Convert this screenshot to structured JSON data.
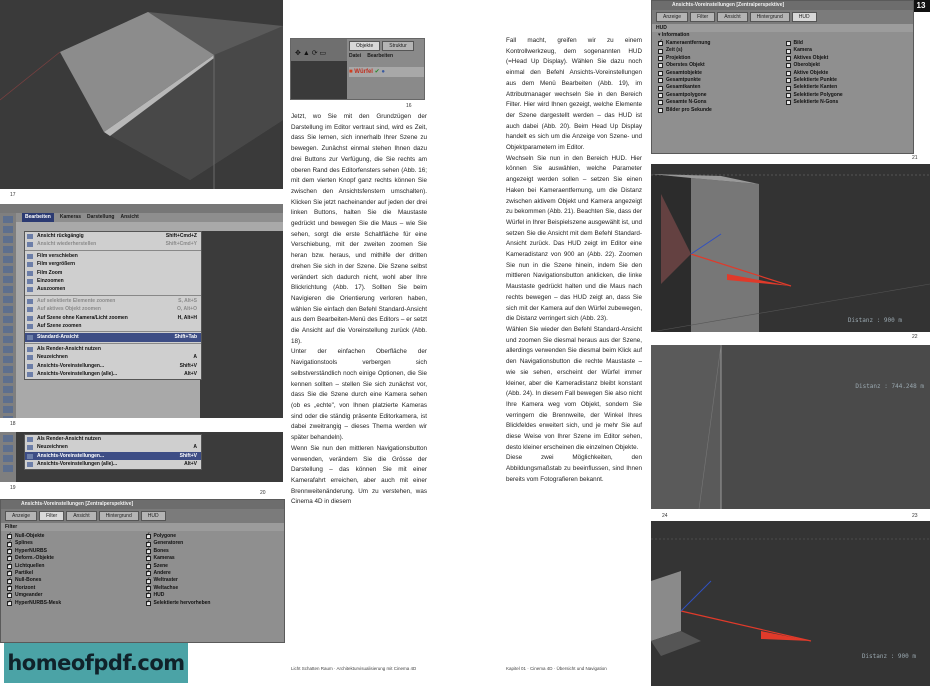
{
  "page_numbers": {
    "left": "12",
    "right": "13"
  },
  "figure_numbers": {
    "f16": "16",
    "f17": "17",
    "f18": "18",
    "f19": "19",
    "f20": "20",
    "f21": "21",
    "f22": "22",
    "f23": "23",
    "f24": "24"
  },
  "fig16": {
    "tabs": [
      "Objekte",
      "Struktur"
    ],
    "menu": [
      "Datei",
      "Bearbeiten"
    ],
    "object_label": "Würfel"
  },
  "fig18": {
    "menubar": [
      "Bearbeiten",
      "Kameras",
      "Darstellung",
      "Ansicht"
    ],
    "items": [
      {
        "label": "Ansicht rückgängig",
        "shortcut": "Shift+Cmd+Z",
        "state": ""
      },
      {
        "label": "Ansicht wiederherstellen",
        "shortcut": "Shift+Cmd+Y",
        "state": "dim"
      },
      {
        "label": "Film verschieben",
        "shortcut": "",
        "state": ""
      },
      {
        "label": "Film vergrößern",
        "shortcut": "",
        "state": ""
      },
      {
        "label": "Film Zoom",
        "shortcut": "",
        "state": ""
      },
      {
        "label": "Einzoomen",
        "shortcut": "",
        "state": ""
      },
      {
        "label": "Auszoomen",
        "shortcut": "",
        "state": ""
      },
      {
        "label": "Auf selektierte Elemente zoomen",
        "shortcut": "S, Alt+S",
        "state": "dim"
      },
      {
        "label": "Auf aktives Objekt zoomen",
        "shortcut": "O, Alt+O",
        "state": "dim"
      },
      {
        "label": "Auf Szene ohne Kamera/Licht zoomen",
        "shortcut": "H, Alt+H",
        "state": ""
      },
      {
        "label": "Auf Szene zoomen",
        "shortcut": "",
        "state": ""
      },
      {
        "label": "Standard-Ansicht",
        "shortcut": "Shift+Tab",
        "state": "hl"
      },
      {
        "label": "Als Render-Ansicht nutzen",
        "shortcut": "",
        "state": ""
      },
      {
        "label": "Neuzeichnen",
        "shortcut": "A",
        "state": ""
      },
      {
        "label": "Ansichts-Voreinstellungen...",
        "shortcut": "Shift+V",
        "state": ""
      },
      {
        "label": "Ansichts-Voreinstellungen (alle)...",
        "shortcut": "Alt+V",
        "state": ""
      }
    ]
  },
  "fig19": {
    "items": [
      {
        "label": "Als Render-Ansicht nutzen",
        "shortcut": "",
        "state": ""
      },
      {
        "label": "Neuzeichnen",
        "shortcut": "A",
        "state": ""
      },
      {
        "label": "Ansichts-Voreinstellungen...",
        "shortcut": "Shift+V",
        "state": "hl"
      },
      {
        "label": "Ansichts-Voreinstellungen (alle)...",
        "shortcut": "Alt+V",
        "state": ""
      }
    ]
  },
  "fig20": {
    "title": "Ansichts-Voreinstellungen [Zentralperspektive]",
    "tabs": [
      "Anzeige",
      "Filter",
      "Ansicht",
      "Hintergrund",
      "HUD"
    ],
    "active_tab": 1,
    "section": "Filter",
    "left": [
      "Null-Objekte",
      "Splines",
      "HyperNURBS",
      "Deform.-Objekte",
      "Lichtquellen",
      "Partikel",
      "Null-Bones",
      "Horizont",
      "Umgeander",
      "HyperNURBS-Mesk"
    ],
    "right": [
      "Polygone",
      "Generatoren",
      "Bones",
      "Kameras",
      "Szene",
      "Andere",
      "Weltraster",
      "Weltachse",
      "HUD",
      "Selektierte hervorheben"
    ]
  },
  "fig21": {
    "title": "Ansichts-Voreinstellungen [Zentralperspektive]",
    "tabs": [
      "Anzeige",
      "Filter",
      "Ansicht",
      "Hintergrund",
      "HUD"
    ],
    "active_tab": 4,
    "section": "HUD",
    "group": "Information",
    "left": [
      "Kameraentfernung",
      "Zeit (s)",
      "Projektion",
      "Oberstes Objekt",
      "Gesamtobjekte",
      "Gesamtpunkte",
      "Gesamtkanten",
      "Gesamtpolygone",
      "Gesamte N-Gons",
      "Bilder pro Sekunde"
    ],
    "left_checked": [
      true,
      false,
      false,
      false,
      false,
      false,
      false,
      false,
      false,
      false
    ],
    "right": [
      "Bild",
      "Kamera",
      "Aktives Objekt",
      "Oberobjekt",
      "Aktive Objekte",
      "Selektierte Punkte",
      "Selektierte Kanten",
      "Selektierte Polygone",
      "Selektierte N-Gons"
    ]
  },
  "distances": {
    "fig22": "Distanz : 900 m",
    "fig23": "Distanz : 744.248 m",
    "fig24": "Distanz : 900 m"
  },
  "col1": [
    "Jetzt, wo Sie mit den Grundzügen der Darstellung im Editor vertraut sind, wird es Zeit, dass Sie lernen, sich innerhalb Ihrer Szene zu bewegen. Zunächst einmal stehen Ihnen dazu drei Buttons zur Verfügung, die Sie rechts am oberen Rand des Editorfensters sehen (Abb. 16; mit dem vierten Knopf ganz rechts können Sie zwischen den Ansichtsfenstern umschalten). Klicken Sie jetzt nacheinander auf jeden der drei linken Buttons, halten Sie die Maustaste gedrückt und bewegen Sie die Maus – wie Sie sehen, sorgt die erste Schaltfläche für eine Verschiebung, mit der zweiten zoomen Sie heran bzw. heraus, und mithilfe der dritten drehen Sie sich in der Szene. Die Szene selbst verändert sich dadurch nicht, wohl aber Ihre Blickrichtung (Abb. 17). Sollten Sie beim Navigieren die Orientierung verloren haben, wählen Sie einfach den Befehl Standard-Ansicht aus dem Bearbeiten-Menü des Editors – er setzt die Ansicht auf die Voreinstellung zurück (Abb. 18).",
    "Unter der einfachen Oberfläche der Navigationstools verbergen sich selbstverständlich noch einige Optionen, die Sie kennen sollten – stellen Sie sich zunächst vor, dass Sie die Szene durch eine Kamera sehen (ob es „echte\", von Ihnen platzierte Kameras sind oder die ständig präsente Editorkamera, ist dabei zweitrangig – dieses Thema werden wir später behandeln).",
    "Wenn Sie nun den mittleren Navigationsbutton verwenden, verändern Sie die Grösse der Darstellung – das können Sie mit einer Kamerafahrt erreichen, aber auch mit einer Brennweitenänderung. Um zu verstehen, was Cinema 4D in diesem"
  ],
  "col2": [
    "Fall macht, greifen wir zu einem Kontrollwerkzeug, dem sogenannten HUD (=Head Up Display). Wählen Sie dazu noch einmal den Befehl Ansichts-Voreinstellungen aus dem Menü Bearbeiten (Abb. 19), im Attributmanager wechseln Sie in den Bereich Filter. Hier wird Ihnen gezeigt, welche Elemente der Szene dargestellt werden – das HUD ist auch dabei (Abb. 20). Beim Head Up Display handelt es sich um die Anzeige von Szene- und Objektparametern im Editor.",
    "Wechseln Sie nun in den Bereich HUD. Hier können Sie auswählen, welche Parameter angezeigt werden sollen – setzen Sie einen Haken bei Kameraentfernung, um die Distanz zwischen aktivem Objekt und Kamera angezeigt zu bekommen (Abb. 21). Beachten Sie, dass der Würfel in Ihrer Beispielszene ausgewählt ist, und setzen Sie die Ansicht mit dem Befehl Standard-Ansicht zurück. Das HUD zeigt im Editor eine Kameradistanz von 900 an (Abb. 22). Zoomen Sie nun in die Szene hinein, indem Sie den mittleren Navigationsbutton anklicken, die linke Maustaste gedrückt halten und die Maus nach rechts bewegen – das HUD zeigt an, dass Sie sich mit der Kamera auf den Würfel zubewegen, die Distanz verringert sich (Abb. 23).",
    "Wählen Sie wieder den Befehl Standard-Ansicht und zoomen Sie diesmal heraus aus der Szene, allerdings verwenden Sie diesmal beim Klick auf den Navigationsbutton die rechte Maustaste – wie sie sehen, erscheint der Würfel immer kleiner, aber die Kameradistanz bleibt konstant (Abb. 24). In diesem Fall bewegen Sie also nicht Ihre Kamera weg vom Objekt, sondern Sie verringern die Brennweite, der Winkel Ihres Blickfeldes erweitert sich, und je mehr Sie auf diese Weise von Ihrer Szene im Editor sehen, desto kleiner erscheinen die einzelnen Objekte.",
    "Diese zwei Möglichkeiten, den Abbildungsmaßstab zu beeinflussen, sind Ihnen bereits vom Fotografieren bekannt."
  ],
  "footers": {
    "left": "Licht Schatten Raum · Architekturvisualisierung mit Cinema 4D",
    "right": "Kapitel 01 · Cinema 4D · Übersicht und Navigation"
  },
  "watermark": "homeofpdf.com",
  "colors": {
    "render_bg": "#353535",
    "ui_panel": "#8f8f8f",
    "highlight": "#3d4d85",
    "accent_red": "#e03a2a",
    "watermark_bg": "#4ba3a6"
  }
}
